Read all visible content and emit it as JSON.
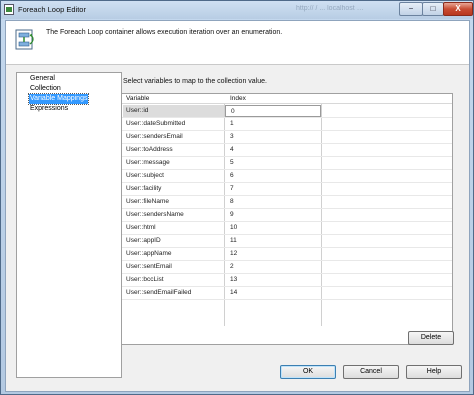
{
  "window": {
    "title": "Foreach Loop Editor",
    "background_title_text": "http://  /  ...  localhost  …",
    "min_glyph": "−",
    "max_glyph": "□",
    "close_glyph": "X"
  },
  "header": {
    "icon": "foreach-loop-icon",
    "description": "The Foreach Loop container allows execution iteration over an enumeration."
  },
  "nav": {
    "items": [
      {
        "label": "General"
      },
      {
        "label": "Collection"
      },
      {
        "label": "Variable Mappings",
        "selected": true
      },
      {
        "label": "Expressions"
      }
    ]
  },
  "mappings": {
    "instruction": "Select variables to map to the collection value.",
    "columns": [
      "Variable",
      "Index"
    ],
    "rows": [
      {
        "variable": "User::id",
        "index": "0"
      },
      {
        "variable": "User::dateSubmitted",
        "index": "1"
      },
      {
        "variable": "User::sendersEmail",
        "index": "3"
      },
      {
        "variable": "User::toAddress",
        "index": "4"
      },
      {
        "variable": "User::message",
        "index": "5"
      },
      {
        "variable": "User::subject",
        "index": "6"
      },
      {
        "variable": "User::facility",
        "index": "7"
      },
      {
        "variable": "User::fileName",
        "index": "8"
      },
      {
        "variable": "User::sendersName",
        "index": "9"
      },
      {
        "variable": "User::html",
        "index": "10"
      },
      {
        "variable": "User::appID",
        "index": "11"
      },
      {
        "variable": "User::appName",
        "index": "12"
      },
      {
        "variable": "User::sentEmail",
        "index": "2"
      },
      {
        "variable": "User::bccList",
        "index": "13"
      },
      {
        "variable": "User::sendEmailFailed",
        "index": "14"
      }
    ]
  },
  "buttons": {
    "delete": "Delete",
    "ok": "OK",
    "cancel": "Cancel",
    "help": "Help"
  },
  "colors": {
    "selection": "#3399ff",
    "title_bar": "#c5d9ee",
    "close_button": "#c84c33"
  }
}
